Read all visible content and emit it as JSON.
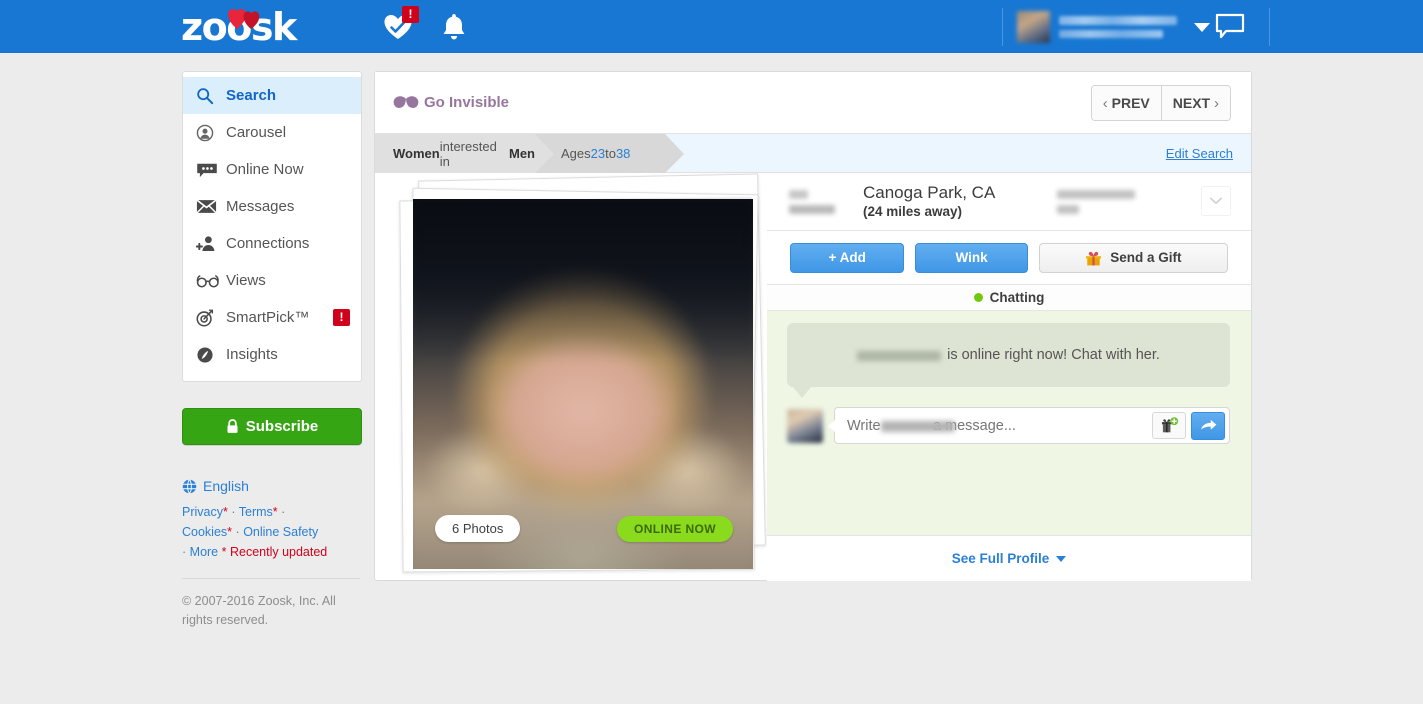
{
  "brand": {
    "name": "zoosk",
    "accent": "#1877d2",
    "green": "#36a513",
    "alert_red": "#d0021b"
  },
  "topbar": {
    "logo_text": "zoosk",
    "matches_icon": "heart-check-icon",
    "matches_badge": "!",
    "notifications_icon": "bell-icon",
    "messages_icon": "speech-bubble-icon",
    "user_caret_icon": "chevron-down-icon",
    "user_name_redacted": "",
    "user_location_redacted": ""
  },
  "sidebar": {
    "items": [
      {
        "label": "Search",
        "icon": "magnifier-icon",
        "active": true,
        "badge": ""
      },
      {
        "label": "Carousel",
        "icon": "carousel-icon",
        "active": false,
        "badge": ""
      },
      {
        "label": "Online Now",
        "icon": "chat-bubble-icon",
        "active": false,
        "badge": ""
      },
      {
        "label": "Messages",
        "icon": "envelope-icon",
        "active": false,
        "badge": ""
      },
      {
        "label": "Connections",
        "icon": "add-person-icon",
        "active": false,
        "badge": ""
      },
      {
        "label": "Views",
        "icon": "glasses-icon",
        "active": false,
        "badge": ""
      },
      {
        "label": "SmartPick™",
        "icon": "target-icon",
        "active": false,
        "badge": "!"
      },
      {
        "label": "Insights",
        "icon": "insights-icon",
        "active": false,
        "badge": ""
      }
    ],
    "subscribe_label": "Subscribe",
    "subscribe_icon": "lock-icon",
    "language": "English",
    "language_icon": "globe-icon",
    "links": {
      "privacy": "Privacy",
      "terms": "Terms",
      "cookies": "Cookies",
      "online_safety": "Online Safety",
      "more": "More",
      "recently_updated": "* Recently updated",
      "asterisk": "*",
      "sep": "·"
    },
    "copyright": "© 2007-2016 Zoosk, Inc. All rights reserved."
  },
  "main": {
    "go_invisible": "Go Invisible",
    "go_invisible_icon": "mask-icon",
    "prev_label": "PREV",
    "next_label": "NEXT",
    "prev_icon": "chevron-left-icon",
    "next_icon": "chevron-right-icon",
    "breadcrumbs": {
      "gender_prefix": "Women",
      "gender_rest": " interested in ",
      "gender_target": "Men",
      "ages_label": "Ages ",
      "age_min": "23",
      "ages_to": " to ",
      "age_max": "38"
    },
    "edit_search": "Edit Search"
  },
  "profile": {
    "photos_badge": "6 Photos",
    "online_badge": "ONLINE NOW",
    "age_redacted": "",
    "city": "Canoga Park, CA",
    "distance": "(24 miles away)",
    "username_redacted": "",
    "dropdown_icon": "chevron-down-icon",
    "actions": {
      "add": "+ Add",
      "wink": "Wink",
      "gift": "Send a Gift",
      "gift_icon": "gift-icon"
    },
    "status": "Chatting",
    "status_dot_color": "#72c80d",
    "see_full_profile": "See Full Profile",
    "see_full_profile_icon": "caret-down-icon"
  },
  "chat": {
    "notice_name_redacted": "",
    "notice_text": "is online right now! Chat with her.",
    "input_placeholder_prefix": "Write ",
    "input_placeholder_name_redacted": "",
    "input_placeholder_suffix": " a message...",
    "input_value": "",
    "gift_button_icon": "gift-add-icon",
    "send_button_icon": "send-arrow-icon"
  }
}
